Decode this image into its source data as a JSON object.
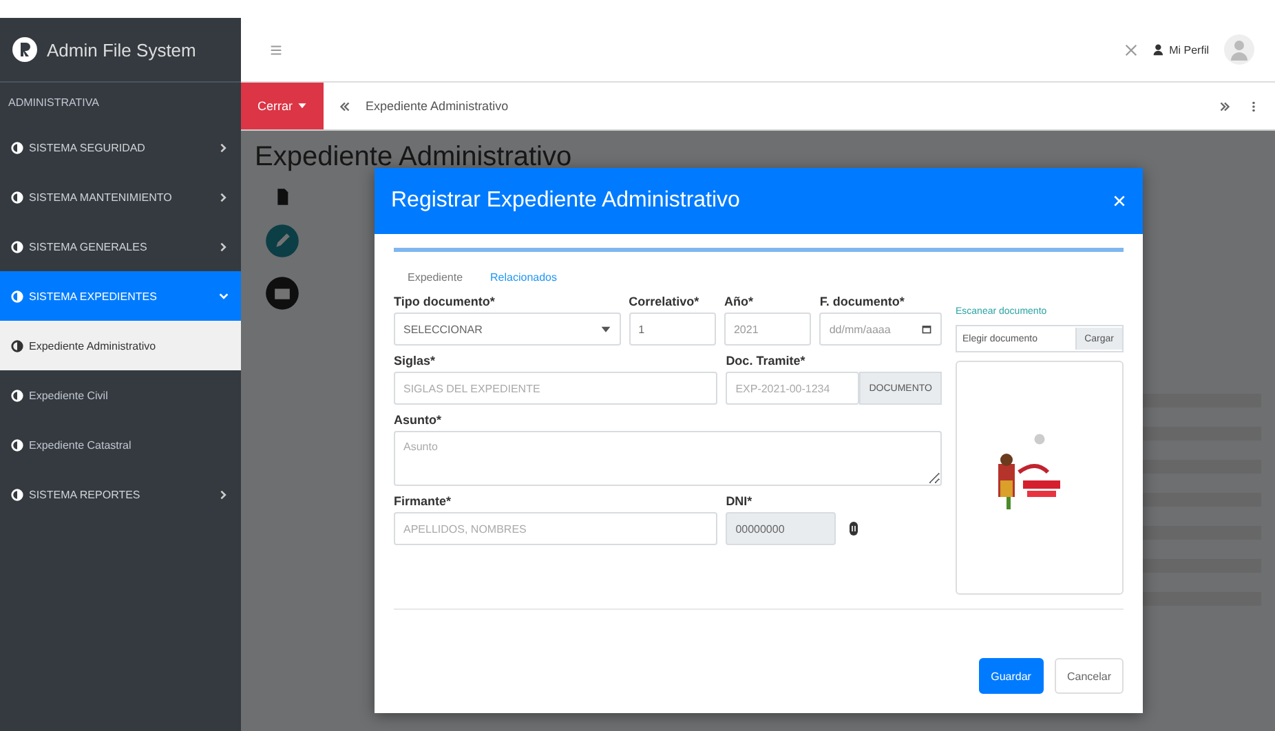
{
  "brand": {
    "title": "Admin File System"
  },
  "sidebar": {
    "header": "ADMINISTRATIVA",
    "items": [
      {
        "label": "SISTEMA SEGURIDAD",
        "expanded": false
      },
      {
        "label": "SISTEMA MANTENIMIENTO",
        "expanded": false
      },
      {
        "label": "SISTEMA GENERALES",
        "expanded": false
      },
      {
        "label": "SISTEMA EXPEDIENTES",
        "expanded": true,
        "children": [
          {
            "label": "Expediente Administrativo",
            "selected": true
          },
          {
            "label": "Expediente Civil",
            "selected": false
          },
          {
            "label": "Expediente Catastral",
            "selected": false
          }
        ]
      },
      {
        "label": "SISTEMA REPORTES",
        "expanded": false
      }
    ]
  },
  "topbar": {
    "profile_link": "Mi Perfil"
  },
  "breadcrumb": {
    "button": "Cerrar",
    "current": "Expediente Administrativo"
  },
  "page": {
    "title": "Expediente Administrativo"
  },
  "modal": {
    "title": "Registrar Expediente Administrativo",
    "tabs": [
      {
        "label": "Expediente",
        "selected": true
      },
      {
        "label": "Relacionados",
        "selected": false
      }
    ],
    "tipo_documento": {
      "label": "Tipo documento*",
      "value": "SELECCIONAR"
    },
    "correlativo": {
      "label": "Correlativo*",
      "value": "1"
    },
    "anio": {
      "label": "Año*",
      "placeholder": "2021"
    },
    "fecha": {
      "label": "F. documento*",
      "placeholder": "dd/mm/aaaa"
    },
    "siglas": {
      "label": "Siglas*",
      "placeholder": "SIGLAS DEL EXPEDIENTE"
    },
    "doc_tramite": {
      "label": "Doc. Tramite*",
      "placeholder": "EXP-2021-00-1234",
      "button": "DOCUMENTO"
    },
    "asunto": {
      "label": "Asunto*",
      "placeholder": "Asunto"
    },
    "firmante": {
      "label": "Firmante*",
      "placeholder": "APELLIDOS, NOMBRES"
    },
    "dni": {
      "label": "DNI*",
      "value": "00000000",
      "disabled": true
    },
    "scan": {
      "label": "Escanear documento",
      "file_placeholder": "Elegir documento",
      "button": "Cargar"
    },
    "buttons": [
      {
        "label": "Guardar",
        "kind": "primary"
      },
      {
        "label": "Cancelar",
        "kind": "secondary"
      }
    ]
  }
}
